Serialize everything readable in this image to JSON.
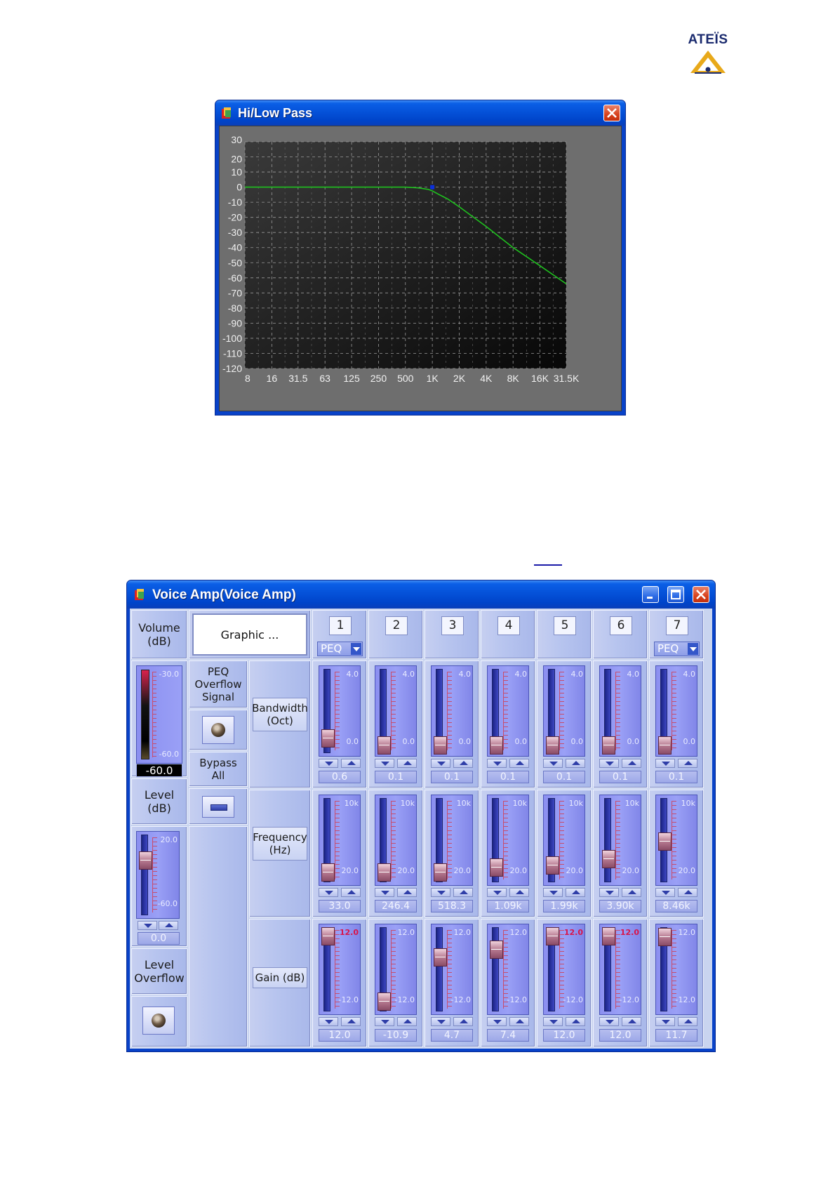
{
  "logo": {
    "text": "ATEÏS"
  },
  "hilow_window": {
    "title": "Hi/Low Pass",
    "app_icon": "app-icon",
    "close_icon": "close-icon",
    "chart_data": {
      "type": "line",
      "title": "",
      "xlabel": "",
      "ylabel": "",
      "xscale": "log",
      "x_ticks": [
        "8",
        "16",
        "31.5",
        "63",
        "125",
        "250",
        "500",
        "1K",
        "2K",
        "4K",
        "8K",
        "16K",
        "31.5K"
      ],
      "x_tick_values": [
        8,
        16,
        31.5,
        63,
        125,
        250,
        500,
        1000,
        2000,
        4000,
        8000,
        16000,
        31500
      ],
      "y_ticks": [
        "30",
        "20",
        "10",
        "0",
        "-10",
        "-20",
        "-30",
        "-40",
        "-50",
        "-60",
        "-70",
        "-80",
        "-90",
        "-100",
        "-110",
        "-120"
      ],
      "ylim": [
        -120,
        30
      ],
      "xlim": [
        8,
        31500
      ],
      "grid": true,
      "series_color": "#1fc21f",
      "marker_color": "#0a2fdc",
      "series": [
        {
          "x": [
            8,
            16,
            31.5,
            63,
            125,
            250,
            500,
            700,
            900,
            1000,
            1200,
            1500,
            2000,
            4000,
            8000,
            16000,
            31500
          ],
          "y": [
            0,
            0,
            0,
            0,
            0,
            0,
            0,
            -0.5,
            -1.5,
            -2.5,
            -5,
            -8,
            -13,
            -26,
            -40,
            -52,
            -64
          ]
        }
      ],
      "marker": {
        "x": 1000,
        "y": 0
      }
    }
  },
  "voice_window": {
    "title": "Voice Amp(Voice Amp)",
    "volume_label": "Volume\n(dB)",
    "graphic_label": "Graphic ...",
    "volume_meter": {
      "max": "-30.0",
      "min": "-60.0",
      "value": "-60.0"
    },
    "peq_overflow_label": "PEQ\nOverflow\nSignal",
    "bypass_label": "Bypass\nAll",
    "level_label": "Level (dB)",
    "level_fader": {
      "max": "20.0",
      "min": "-60.0",
      "value": "0.0",
      "position": 0.75
    },
    "level_overflow_label": "Level\nOverflow",
    "row_labels": {
      "bandwidth": "Bandwidth\n(Oct)",
      "frequency": "Frequency\n(Hz)",
      "gain": "Gain (dB)"
    },
    "bands": [
      {
        "num": "1",
        "type": "PEQ",
        "bw": "0.6",
        "freq": "33.0",
        "gain": "12.0",
        "bw_pos": 0.12,
        "freq_pos": 0.05,
        "gain_pos": 1.0
      },
      {
        "num": "2",
        "type": "",
        "bw": "0.1",
        "freq": "246.4",
        "gain": "-10.9",
        "bw_pos": 0.02,
        "freq_pos": 0.05,
        "gain_pos": 0.05
      },
      {
        "num": "3",
        "type": "",
        "bw": "0.1",
        "freq": "518.3",
        "gain": "4.7",
        "bw_pos": 0.02,
        "freq_pos": 0.05,
        "gain_pos": 0.69
      },
      {
        "num": "4",
        "type": "",
        "bw": "0.1",
        "freq": "1.09k",
        "gain": "7.4",
        "bw_pos": 0.02,
        "freq_pos": 0.12,
        "gain_pos": 0.81
      },
      {
        "num": "5",
        "type": "",
        "bw": "0.1",
        "freq": "1.99k",
        "gain": "12.0",
        "bw_pos": 0.02,
        "freq_pos": 0.15,
        "gain_pos": 1.0
      },
      {
        "num": "6",
        "type": "",
        "bw": "0.1",
        "freq": "3.90k",
        "gain": "12.0",
        "bw_pos": 0.02,
        "freq_pos": 0.25,
        "gain_pos": 1.0
      },
      {
        "num": "7",
        "type": "PEQ",
        "bw": "0.1",
        "freq": "8.46k",
        "gain": "11.7",
        "bw_pos": 0.02,
        "freq_pos": 0.5,
        "gain_pos": 0.99
      }
    ],
    "fader_ranges": {
      "bw": {
        "max": "4.0",
        "min": "0.0"
      },
      "freq": {
        "max": "10k",
        "min": "20.0"
      },
      "gain": {
        "max": "12.0",
        "min": "-12.0"
      }
    },
    "colors": {
      "hot_label": "#d8154a",
      "panel": "#b8c5ef",
      "fader": "#9aa0f6"
    }
  }
}
